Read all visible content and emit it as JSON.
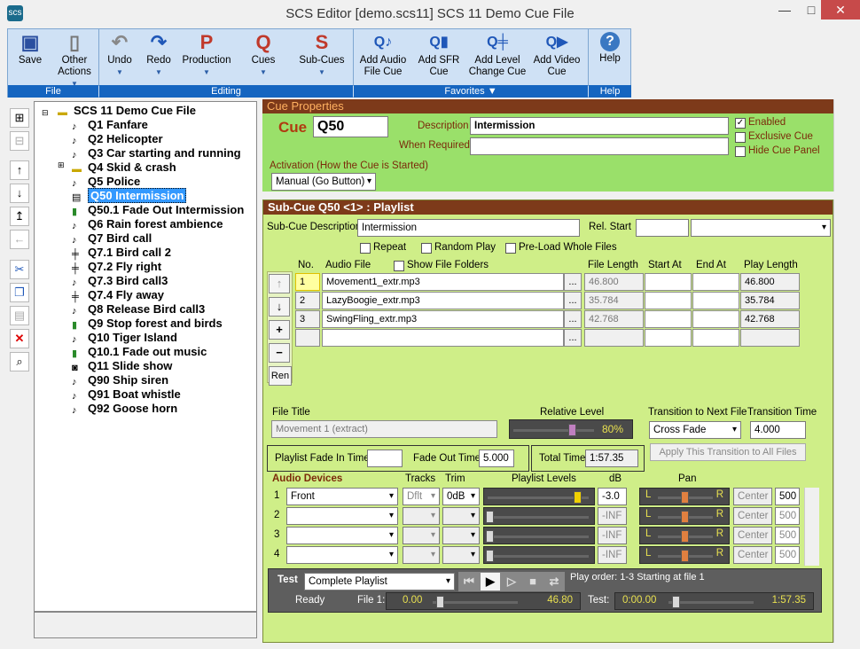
{
  "window": {
    "title": "SCS Editor  [demo.scs11]  SCS 11 Demo Cue File",
    "min": "—",
    "max": "□",
    "close": "✕",
    "app_icon": "scs"
  },
  "ribbon": {
    "groups": [
      {
        "label": "File",
        "buttons": [
          {
            "label": "Save",
            "icon": "save-icon"
          },
          {
            "label": "Other Actions",
            "icon": "page-icon"
          }
        ]
      },
      {
        "label": "Editing",
        "buttons": [
          {
            "label": "Undo"
          },
          {
            "label": "Redo"
          },
          {
            "label": "Production"
          },
          {
            "label": "Cues"
          },
          {
            "label": "Sub-Cues"
          }
        ]
      },
      {
        "label": "Favorites ▼",
        "buttons": [
          {
            "label": "Add Audio File Cue"
          },
          {
            "label": "Add SFR Cue"
          },
          {
            "label": "Add Level Change Cue"
          },
          {
            "label": "Add Video Cue"
          }
        ]
      },
      {
        "label": "Help",
        "buttons": [
          {
            "label": "Help"
          }
        ]
      }
    ],
    "glyphs": {
      "undo": "↶",
      "redo": "↷",
      "production": "P",
      "cues": "Q",
      "subcues": "S",
      "help": "?"
    }
  },
  "tree": {
    "root": "SCS 11 Demo Cue File",
    "items": [
      "Q1 Fanfare",
      "Q2 Helicopter",
      "Q3 Car starting and running",
      "Q4 Skid & crash",
      "Q5 Police",
      "Q50 Intermission",
      "Q50.1 Fade Out Intermission",
      "Q6 Rain forest ambience",
      "Q7 Bird call",
      "Q7.1 Bird call 2",
      "Q7.2 Fly right",
      "Q7.3 Bird call3",
      "Q7.4 Fly away",
      "Q8 Release Bird call3",
      "Q9 Stop forest and birds",
      "Q10 Tiger Island",
      "Q10.1 Fade out music",
      "Q11 Slide show",
      "Q90 Ship siren",
      "Q91 Boat whistle",
      "Q92 Goose horn"
    ]
  },
  "cue_props": {
    "header": "Cue Properties",
    "cue_label": "Cue",
    "cue_value": "Q50",
    "desc_label": "Description",
    "desc_value": "Intermission",
    "when_label": "When Required",
    "when_value": "",
    "enabled": "Enabled",
    "exclusive": "Exclusive Cue",
    "hide": "Hide Cue Panel",
    "check": "✓",
    "activation_label": "Activation (How the Cue is Started)",
    "activation_value": "Manual (Go Button)"
  },
  "subcue": {
    "header": "Sub-Cue Q50 <1> : Playlist",
    "desc_label": "Sub-Cue Description",
    "desc_value": "Intermission",
    "relstart_label": "Rel. Start",
    "repeat": "Repeat",
    "random": "Random Play",
    "preload": "Pre-Load Whole Files",
    "cols": {
      "no": "No.",
      "file": "Audio File",
      "showfolders": "Show File Folders",
      "len": "File Length",
      "start": "Start At",
      "end": "End At",
      "play": "Play Length"
    },
    "rows": [
      {
        "no": "1",
        "file": "Movement1_extr.mp3",
        "len": "46.800",
        "play": "46.800"
      },
      {
        "no": "2",
        "file": "LazyBoogie_extr.mp3",
        "len": "35.784",
        "play": "35.784"
      },
      {
        "no": "3",
        "file": "SwingFling_extr.mp3",
        "len": "42.768",
        "play": "42.768"
      }
    ],
    "browse": "...",
    "side_buttons": {
      "up": "↑",
      "down": "↓",
      "add": "+",
      "remove": "−",
      "ren": "Ren"
    },
    "file_title_label": "File Title",
    "file_title_value": "Movement 1 (extract)",
    "rel_level_label": "Relative Level",
    "rel_level_value": "80%",
    "rel_level_fraction": 0.8,
    "trans_label": "Transition to Next File",
    "trans_value": "Cross Fade",
    "trans_time_label": "Transition Time",
    "trans_time_value": "4.000",
    "fadein_label": "Playlist Fade In Time",
    "fadein_value": "",
    "fadeout_label": "Fade Out Time",
    "fadeout_value": "5.000",
    "total_label": "Total Time",
    "total_value": "1:57.35",
    "apply_label": "Apply This Transition to All Files",
    "dev_cols": {
      "devices": "Audio Devices",
      "tracks": "Tracks",
      "trim": "Trim",
      "levels": "Playlist Levels",
      "db": "dB",
      "pan": "Pan"
    },
    "devices": [
      {
        "n": "1",
        "name": "Front",
        "tracks": "Dflt",
        "trim": "0dB",
        "db": "-3.0",
        "center": "Center",
        "pan": "500",
        "level": 0.95
      },
      {
        "n": "2",
        "name": "",
        "tracks": "",
        "trim": "",
        "db": "-INF",
        "center": "Center",
        "pan": "500",
        "level": 0
      },
      {
        "n": "3",
        "name": "",
        "tracks": "",
        "trim": "",
        "db": "-INF",
        "center": "Center",
        "pan": "500",
        "level": 0
      },
      {
        "n": "4",
        "name": "",
        "tracks": "",
        "trim": "",
        "db": "-INF",
        "center": "Center",
        "pan": "500",
        "level": 0
      }
    ],
    "pan_l": "L",
    "pan_r": "R",
    "test": {
      "label": "Test",
      "mode": "Complete Playlist",
      "play_order": "Play order: 1-3 Starting at file 1",
      "ready": "Ready",
      "file_label": "File 1:",
      "file_start": "0.00",
      "file_end": "46.80",
      "test_label": "Test:",
      "test_start": "0:00.00",
      "test_end": "1:57.35",
      "transport": [
        "⏮",
        "▶",
        "▷",
        "■",
        "⇄"
      ]
    }
  }
}
